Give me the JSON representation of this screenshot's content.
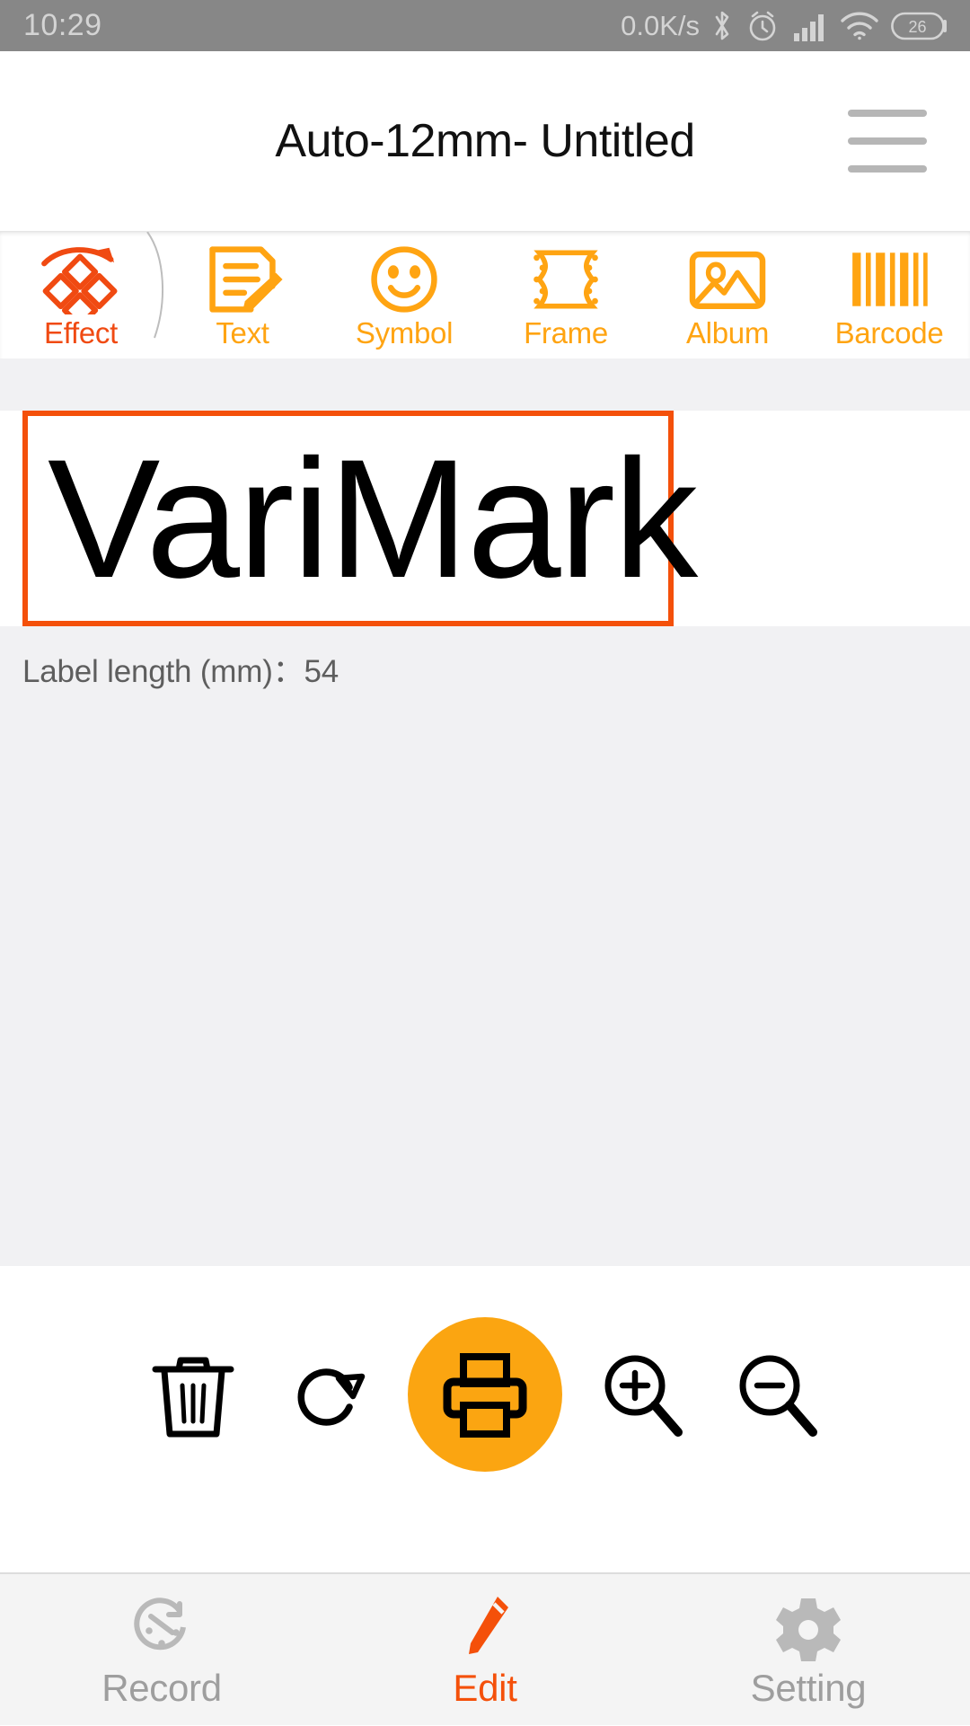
{
  "status_bar": {
    "time": "10:29",
    "net_speed": "0.0K/s",
    "battery_level": "26",
    "icons": [
      "bluetooth-icon",
      "alarm-icon",
      "signal-icon",
      "wifi-icon",
      "battery-icon"
    ],
    "background_color": "#878787",
    "text_color": "#d4d4d4"
  },
  "title_bar": {
    "title": "Auto-12mm- Untitled",
    "menu_icon": "hamburger-menu-icon"
  },
  "toolbar": {
    "items": [
      {
        "label": "Effect",
        "icon": "effect-diamonds-icon",
        "active": true,
        "color": "#F04A12"
      },
      {
        "label": "Text",
        "icon": "text-document-pencil-icon",
        "active": false,
        "color": "#FFA412"
      },
      {
        "label": "Symbol",
        "icon": "symbol-smiley-icon",
        "active": false,
        "color": "#FFA412"
      },
      {
        "label": "Frame",
        "icon": "frame-icon",
        "active": false,
        "color": "#FFA412"
      },
      {
        "label": "Album",
        "icon": "album-picture-icon",
        "active": false,
        "color": "#FFA412"
      },
      {
        "label": "Barcode",
        "icon": "barcode-icon",
        "active": false,
        "color": "#FFA412"
      }
    ]
  },
  "canvas": {
    "label_text": "VariMark",
    "label_length_text": "Label length (mm)：54",
    "label_length_value": "54",
    "selection_border_color": "#F4500A",
    "background_color": "#f1f1f3"
  },
  "action_bar": {
    "buttons": [
      {
        "name": "delete",
        "icon": "trash-icon"
      },
      {
        "name": "rotate",
        "icon": "rotate-clockwise-icon"
      },
      {
        "name": "print",
        "icon": "printer-icon",
        "accent": "#FBA511"
      },
      {
        "name": "zoom-in",
        "icon": "zoom-in-icon"
      },
      {
        "name": "zoom-out",
        "icon": "zoom-out-icon"
      }
    ]
  },
  "bottom_nav": {
    "items": [
      {
        "label": "Record",
        "icon": "history-clock-icon",
        "active": false
      },
      {
        "label": "Edit",
        "icon": "pencil-icon",
        "active": true
      },
      {
        "label": "Setting",
        "icon": "gear-icon",
        "active": false
      }
    ],
    "active_color": "#F4500A",
    "inactive_color": "#9e9e9e"
  }
}
